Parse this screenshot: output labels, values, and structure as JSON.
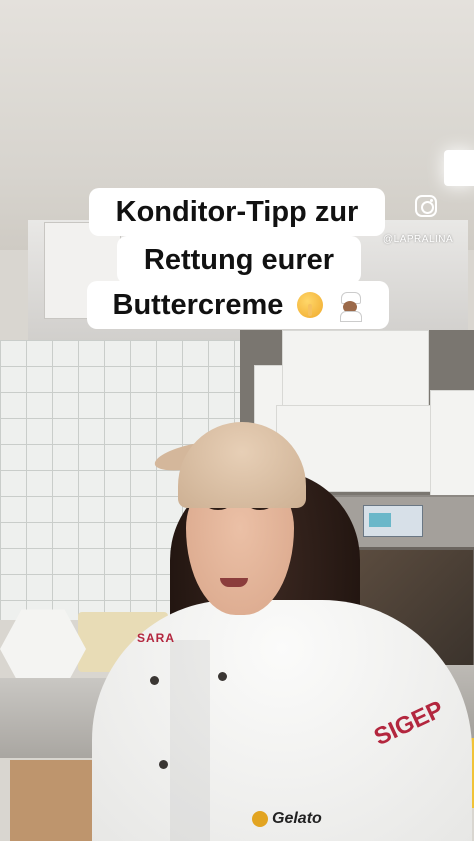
{
  "overlay": {
    "caption": {
      "line1": "Konditor-Tipp zur",
      "line2": "Rettung eurer",
      "line3": "Buttercreme",
      "emojis": [
        "shushing-face-emoji",
        "chef-emoji"
      ]
    },
    "instagram": {
      "icon": "instagram-icon",
      "handle": "@LAPRALINA"
    }
  },
  "scene": {
    "jacket_text": {
      "left_logo": "SARA",
      "right_logo": "SIGEP",
      "bottom_logo": "Gelato"
    }
  }
}
